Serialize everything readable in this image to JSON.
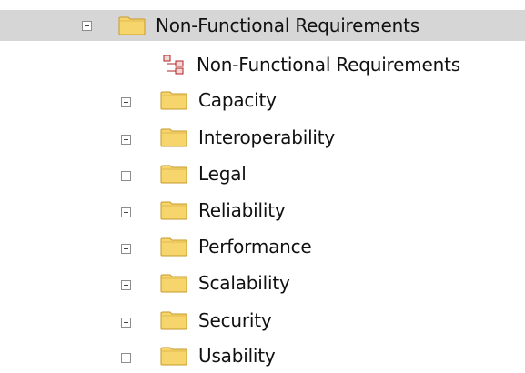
{
  "tree": {
    "root": {
      "label": "Non-Functional Requirements",
      "expanded": true,
      "selected": true,
      "icon": "folder-icon"
    },
    "diagram": {
      "label": "Non-Functional Requirements",
      "icon": "diagram-icon"
    },
    "children": [
      {
        "label": "Capacity",
        "expanded": false,
        "icon": "folder-icon"
      },
      {
        "label": "Interoperability",
        "expanded": false,
        "icon": "folder-icon"
      },
      {
        "label": "Legal",
        "expanded": false,
        "icon": "folder-icon"
      },
      {
        "label": "Reliability",
        "expanded": false,
        "icon": "folder-icon"
      },
      {
        "label": "Performance",
        "expanded": false,
        "icon": "folder-icon"
      },
      {
        "label": "Scalability",
        "expanded": false,
        "icon": "folder-icon"
      },
      {
        "label": "Security",
        "expanded": false,
        "icon": "folder-icon"
      },
      {
        "label": "Usability",
        "expanded": false,
        "icon": "folder-icon"
      }
    ],
    "colors": {
      "folder_fill": "#f7d56d",
      "folder_stroke": "#c79a2a",
      "selection": "#d6d6d6"
    }
  }
}
